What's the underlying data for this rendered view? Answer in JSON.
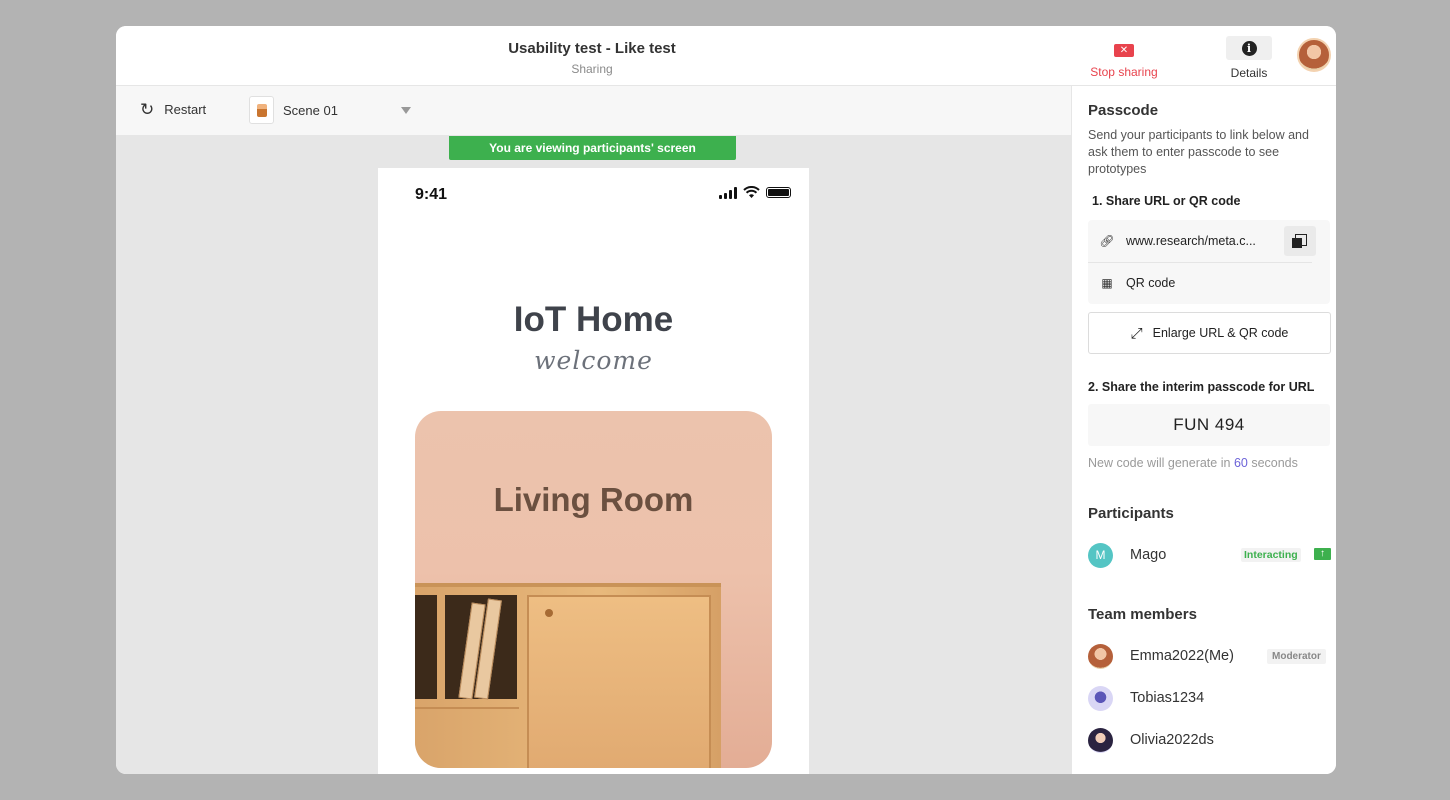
{
  "header": {
    "title": "Usability test - Like test",
    "subtitle": "Sharing",
    "stop_label": "Stop sharing",
    "details_label": "Details"
  },
  "toolbar": {
    "restart_label": "Restart",
    "scene_label": "Scene 01"
  },
  "canvas": {
    "banner": "You are viewing participants' screen"
  },
  "phone": {
    "time": "9:41",
    "app_title": "IoT Home",
    "app_subtitle": "welcome",
    "room_title": "Living Room"
  },
  "sidebar": {
    "passcode_heading": "Passcode",
    "passcode_desc": "Send your participants to link below and ask them to enter passcode to see prototypes",
    "step1": "1. Share URL or QR code",
    "url": "www.research/meta.c...",
    "qr_label": "QR code",
    "enlarge_label": "Enlarge URL & QR code",
    "step2": "2. Share the interim passcode for URL",
    "passcode": "FUN 494",
    "new_code_prefix": "New code will generate in",
    "new_code_seconds": "60",
    "new_code_suffix": "seconds",
    "participants_heading": "Participants",
    "participants": [
      {
        "initial": "M",
        "name": "Mago",
        "status": "Interacting"
      }
    ],
    "team_heading": "Team members",
    "team": [
      {
        "name": "Emma2022(Me)",
        "role": "Moderator"
      },
      {
        "name": "Tobias1234"
      },
      {
        "name": "Olivia2022ds"
      }
    ]
  },
  "colors": {
    "accent_green": "#3db04e",
    "stop_red": "#e8434d",
    "countdown_purple": "#6c63d8"
  }
}
